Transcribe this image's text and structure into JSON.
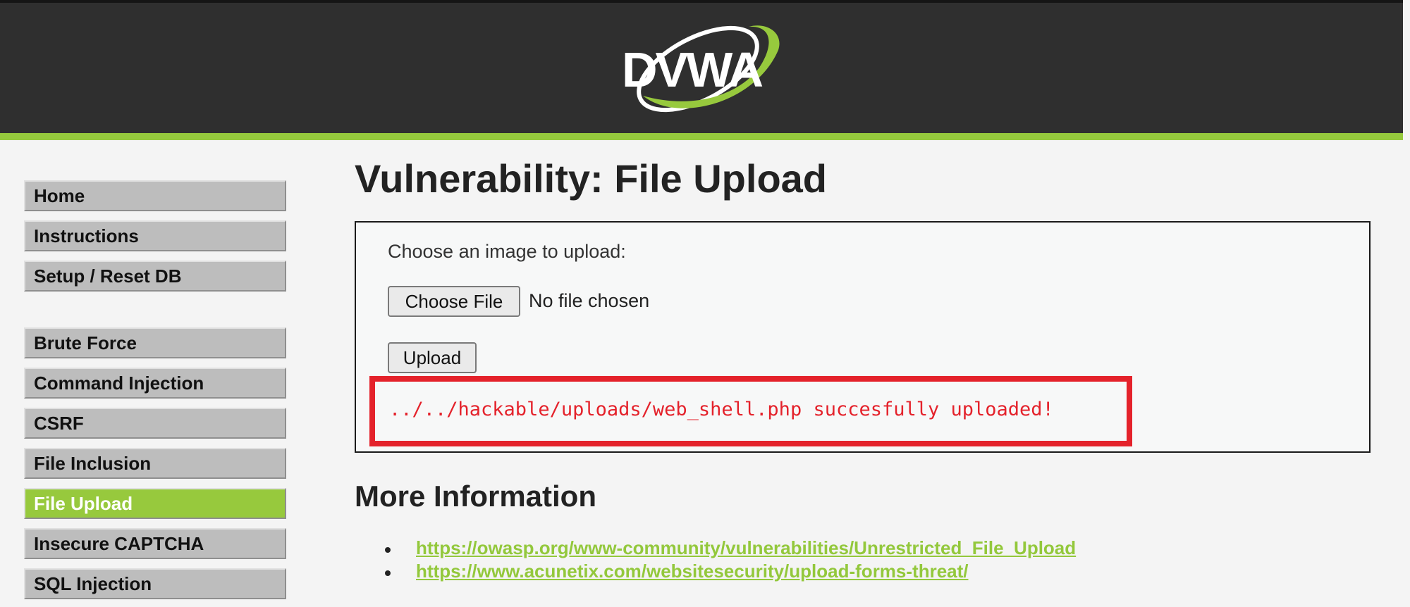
{
  "header": {
    "logo_text": "DVWA"
  },
  "nav": {
    "items": [
      {
        "label": "Home"
      },
      {
        "label": "Instructions"
      },
      {
        "label": "Setup / Reset DB"
      },
      {
        "label": "Brute Force"
      },
      {
        "label": "Command Injection"
      },
      {
        "label": "CSRF"
      },
      {
        "label": "File Inclusion"
      },
      {
        "label": "File Upload",
        "active": true
      },
      {
        "label": "Insecure CAPTCHA"
      },
      {
        "label": "SQL Injection"
      }
    ]
  },
  "main": {
    "title": "Vulnerability: File Upload",
    "upload": {
      "prompt": "Choose an image to upload:",
      "choose_file_label": "Choose File",
      "file_status": "No file chosen",
      "upload_label": "Upload",
      "result_message": "../../hackable/uploads/web_shell.php succesfully uploaded!"
    },
    "more_info": {
      "title": "More Information",
      "links": [
        "https://owasp.org/www-community/vulnerabilities/Unrestricted_File_Upload",
        "https://www.acunetix.com/websitesecurity/upload-forms-threat/"
      ]
    }
  },
  "colors": {
    "header_bg": "#2f2f2f",
    "accent_green": "#95c93d",
    "highlight_red": "#e4222b"
  }
}
